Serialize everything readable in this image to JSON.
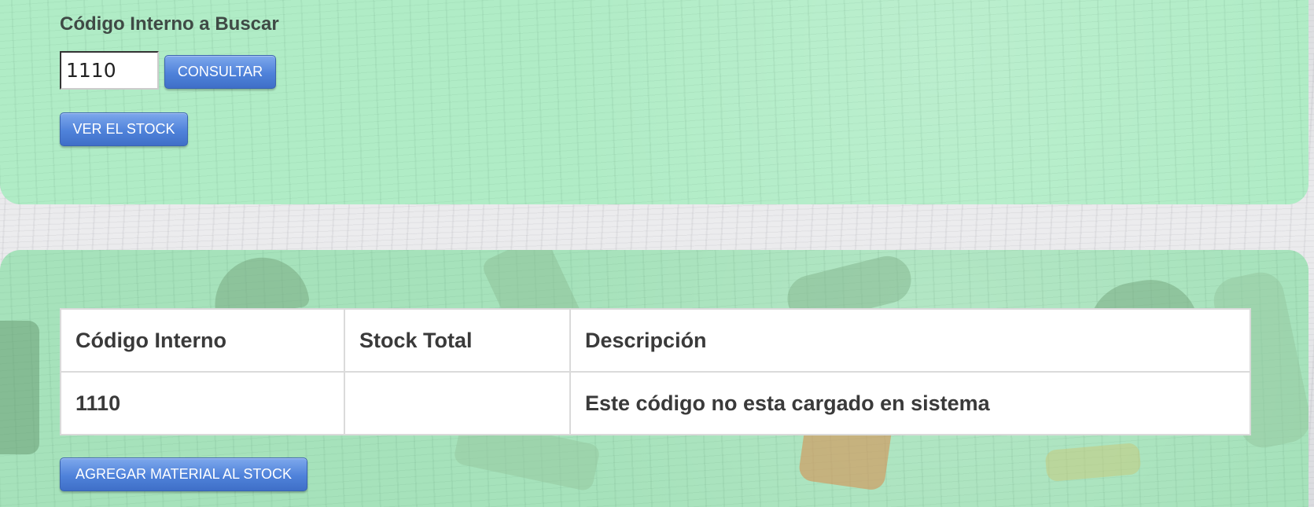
{
  "search": {
    "title": "Código Interno a Buscar",
    "input_value": "1110",
    "consultar_label": "CONSULTAR",
    "ver_stock_label": "VER EL STOCK"
  },
  "table": {
    "headers": [
      "Código Interno",
      "Stock Total",
      "Descripción"
    ],
    "rows": [
      [
        "1110",
        "",
        "Este código no esta cargado en sistema"
      ]
    ]
  },
  "actions": {
    "agregar_label": "AGREGAR MATERIAL AL STOCK"
  },
  "colors": {
    "panel_green": "#b0ecc6",
    "button_blue": "#4f82da"
  }
}
